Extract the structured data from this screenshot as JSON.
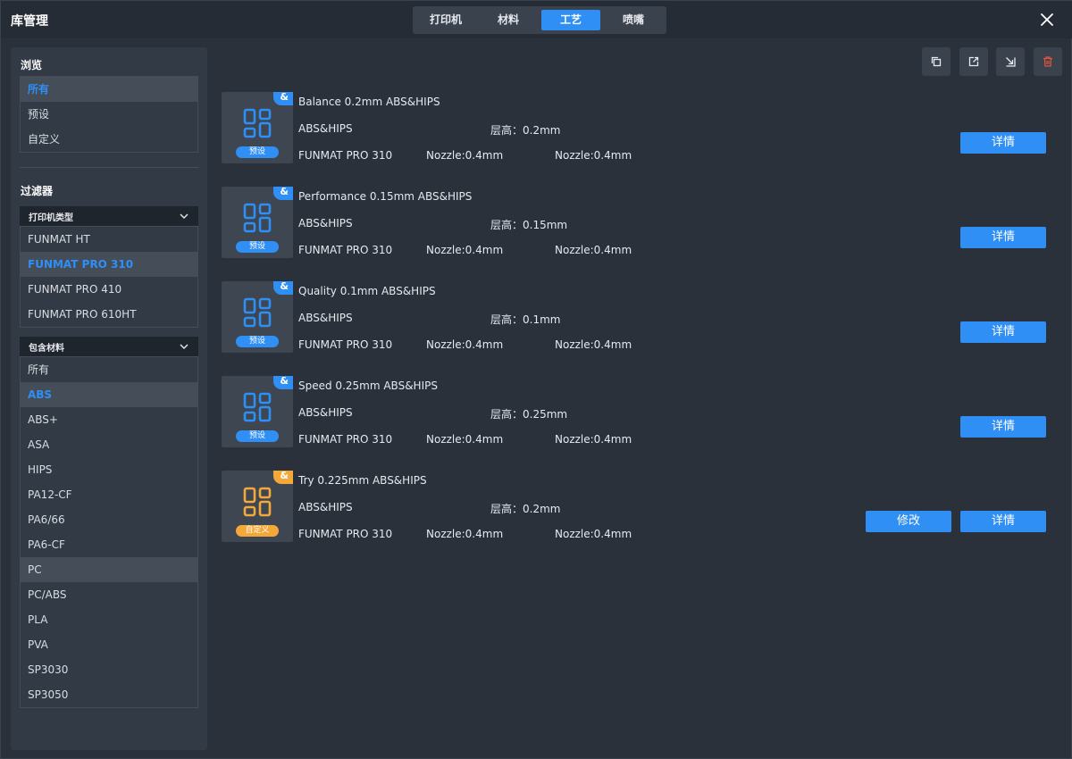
{
  "window": {
    "title": "库管理"
  },
  "tabs": [
    {
      "label": "打印机",
      "active": false
    },
    {
      "label": "材料",
      "active": false
    },
    {
      "label": "工艺",
      "active": true
    },
    {
      "label": "喷嘴",
      "active": false
    }
  ],
  "colors": {
    "accent": "#2f8ff5",
    "custom": "#f5a83a",
    "danger": "#e0523f",
    "panel": "#323a45"
  },
  "sidebar": {
    "browse_title": "浏览",
    "browse_items": [
      {
        "label": "所有",
        "selected": true
      },
      {
        "label": "预设",
        "selected": false
      },
      {
        "label": "自定义",
        "selected": false
      }
    ],
    "filter_title": "过滤器",
    "printer_type": {
      "label": "打印机类型",
      "items": [
        {
          "label": "FUNMAT HT",
          "selected": false
        },
        {
          "label": "FUNMAT PRO 310",
          "selected": true
        },
        {
          "label": "FUNMAT PRO 410",
          "selected": false
        },
        {
          "label": "FUNMAT PRO 610HT",
          "selected": false
        }
      ]
    },
    "material": {
      "label": "包含材料",
      "items": [
        {
          "label": "所有",
          "selected": false
        },
        {
          "label": "ABS",
          "selected": true
        },
        {
          "label": "ABS+",
          "selected": false
        },
        {
          "label": "ASA",
          "selected": false
        },
        {
          "label": "HIPS",
          "selected": false
        },
        {
          "label": "PA12-CF",
          "selected": false
        },
        {
          "label": "PA6/66",
          "selected": false
        },
        {
          "label": "PA6-CF",
          "selected": false
        },
        {
          "label": "PC",
          "selected": false,
          "hover": true
        },
        {
          "label": "PC/ABS",
          "selected": false
        },
        {
          "label": "PLA",
          "selected": false
        },
        {
          "label": "PVA",
          "selected": false
        },
        {
          "label": "SP3030",
          "selected": false
        },
        {
          "label": "SP3050",
          "selected": false
        }
      ]
    }
  },
  "toolbar": {
    "icons": [
      "copy-icon",
      "export-icon",
      "import-icon",
      "delete-icon"
    ]
  },
  "profiles": [
    {
      "name": "Balance 0.2mm ABS&HIPS",
      "material": "ABS&HIPS",
      "layer": "层高：0.2mm",
      "printer": "FUNMAT PRO 310",
      "nozzle1": "Nozzle:0.4mm",
      "nozzle2": "Nozzle:0.4mm",
      "badge": "预设",
      "corner": "&",
      "type": "preset",
      "details_label": "详情"
    },
    {
      "name": "Performance 0.15mm ABS&HIPS",
      "material": "ABS&HIPS",
      "layer": "层高：0.15mm",
      "printer": "FUNMAT PRO 310",
      "nozzle1": "Nozzle:0.4mm",
      "nozzle2": "Nozzle:0.4mm",
      "badge": "预设",
      "corner": "&",
      "type": "preset",
      "details_label": "详情"
    },
    {
      "name": "Quality 0.1mm ABS&HIPS",
      "material": "ABS&HIPS",
      "layer": "层高：0.1mm",
      "printer": "FUNMAT PRO 310",
      "nozzle1": "Nozzle:0.4mm",
      "nozzle2": "Nozzle:0.4mm",
      "badge": "预设",
      "corner": "&",
      "type": "preset",
      "details_label": "详情"
    },
    {
      "name": "Speed 0.25mm ABS&HIPS",
      "material": "ABS&HIPS",
      "layer": "层高：0.25mm",
      "printer": "FUNMAT PRO 310",
      "nozzle1": "Nozzle:0.4mm",
      "nozzle2": "Nozzle:0.4mm",
      "badge": "预设",
      "corner": "&",
      "type": "preset",
      "details_label": "详情"
    },
    {
      "name": "Try 0.225mm ABS&HIPS",
      "material": "ABS&HIPS",
      "layer": "层高：0.2mm",
      "printer": "FUNMAT PRO 310",
      "nozzle1": "Nozzle:0.4mm",
      "nozzle2": "Nozzle:0.4mm",
      "badge": "自定义",
      "corner": "&",
      "type": "custom",
      "details_label": "详情",
      "modify_label": "修改"
    }
  ]
}
